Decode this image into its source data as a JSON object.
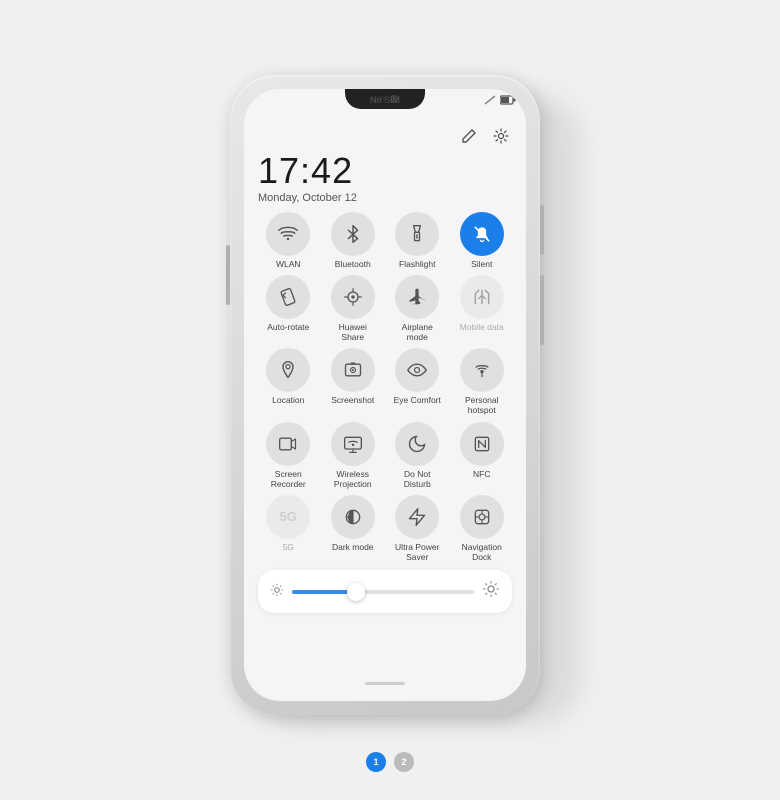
{
  "phone": {
    "status_bar": {
      "sim": "No SIM",
      "time": "17:42",
      "date": "Monday, October 12"
    },
    "toolbar": {
      "edit_icon": "✏",
      "settings_icon": "⚙"
    },
    "clock": {
      "time": "17:42",
      "date": "Monday, October 12"
    },
    "quick_toggles": [
      {
        "id": "wlan",
        "label": "WLAN",
        "icon": "wifi",
        "active": false,
        "disabled": false
      },
      {
        "id": "bluetooth",
        "label": "Bluetooth",
        "icon": "bluetooth",
        "active": false,
        "disabled": false
      },
      {
        "id": "flashlight",
        "label": "Flashlight",
        "icon": "flashlight",
        "active": false,
        "disabled": false
      },
      {
        "id": "silent",
        "label": "Silent",
        "icon": "silent",
        "active": true,
        "disabled": false
      },
      {
        "id": "auto-rotate",
        "label": "Auto-rotate",
        "icon": "rotate",
        "active": false,
        "disabled": false
      },
      {
        "id": "huawei-share",
        "label": "Huawei Share",
        "icon": "share",
        "active": false,
        "disabled": false
      },
      {
        "id": "airplane",
        "label": "Airplane mode",
        "icon": "airplane",
        "active": false,
        "disabled": false
      },
      {
        "id": "mobile-data",
        "label": "Mobile data",
        "icon": "data",
        "active": false,
        "disabled": true
      },
      {
        "id": "location",
        "label": "Location",
        "icon": "location",
        "active": false,
        "disabled": false
      },
      {
        "id": "screenshot",
        "label": "Screenshot",
        "icon": "screenshot",
        "active": false,
        "disabled": false
      },
      {
        "id": "eye-comfort",
        "label": "Eye Comfort",
        "icon": "eye",
        "active": false,
        "disabled": false
      },
      {
        "id": "personal-hotspot",
        "label": "Personal hotspot",
        "icon": "hotspot",
        "active": false,
        "disabled": false
      },
      {
        "id": "screen-recorder",
        "label": "Screen Recorder",
        "icon": "recorder",
        "active": false,
        "disabled": false
      },
      {
        "id": "wireless-projection",
        "label": "Wireless Projection",
        "icon": "projection",
        "active": false,
        "disabled": false
      },
      {
        "id": "do-not-disturb",
        "label": "Do Not Disturb",
        "icon": "moon",
        "active": false,
        "disabled": false
      },
      {
        "id": "nfc",
        "label": "NFC",
        "icon": "nfc",
        "active": false,
        "disabled": false
      },
      {
        "id": "5g",
        "label": "5G",
        "icon": "5g",
        "active": false,
        "disabled": true
      },
      {
        "id": "dark-mode",
        "label": "Dark mode",
        "icon": "darkmode",
        "active": false,
        "disabled": false
      },
      {
        "id": "ultra-power-saver",
        "label": "Ultra Power Saver",
        "icon": "power",
        "active": false,
        "disabled": false
      },
      {
        "id": "navigation-dock",
        "label": "Navigation Dock",
        "icon": "navdock",
        "active": false,
        "disabled": false
      }
    ],
    "brightness": {
      "value": 35,
      "min_icon": "☀",
      "max_icon": "☀"
    },
    "nav_dots": [
      {
        "label": "1",
        "active": true
      },
      {
        "label": "2",
        "active": false
      }
    ]
  }
}
